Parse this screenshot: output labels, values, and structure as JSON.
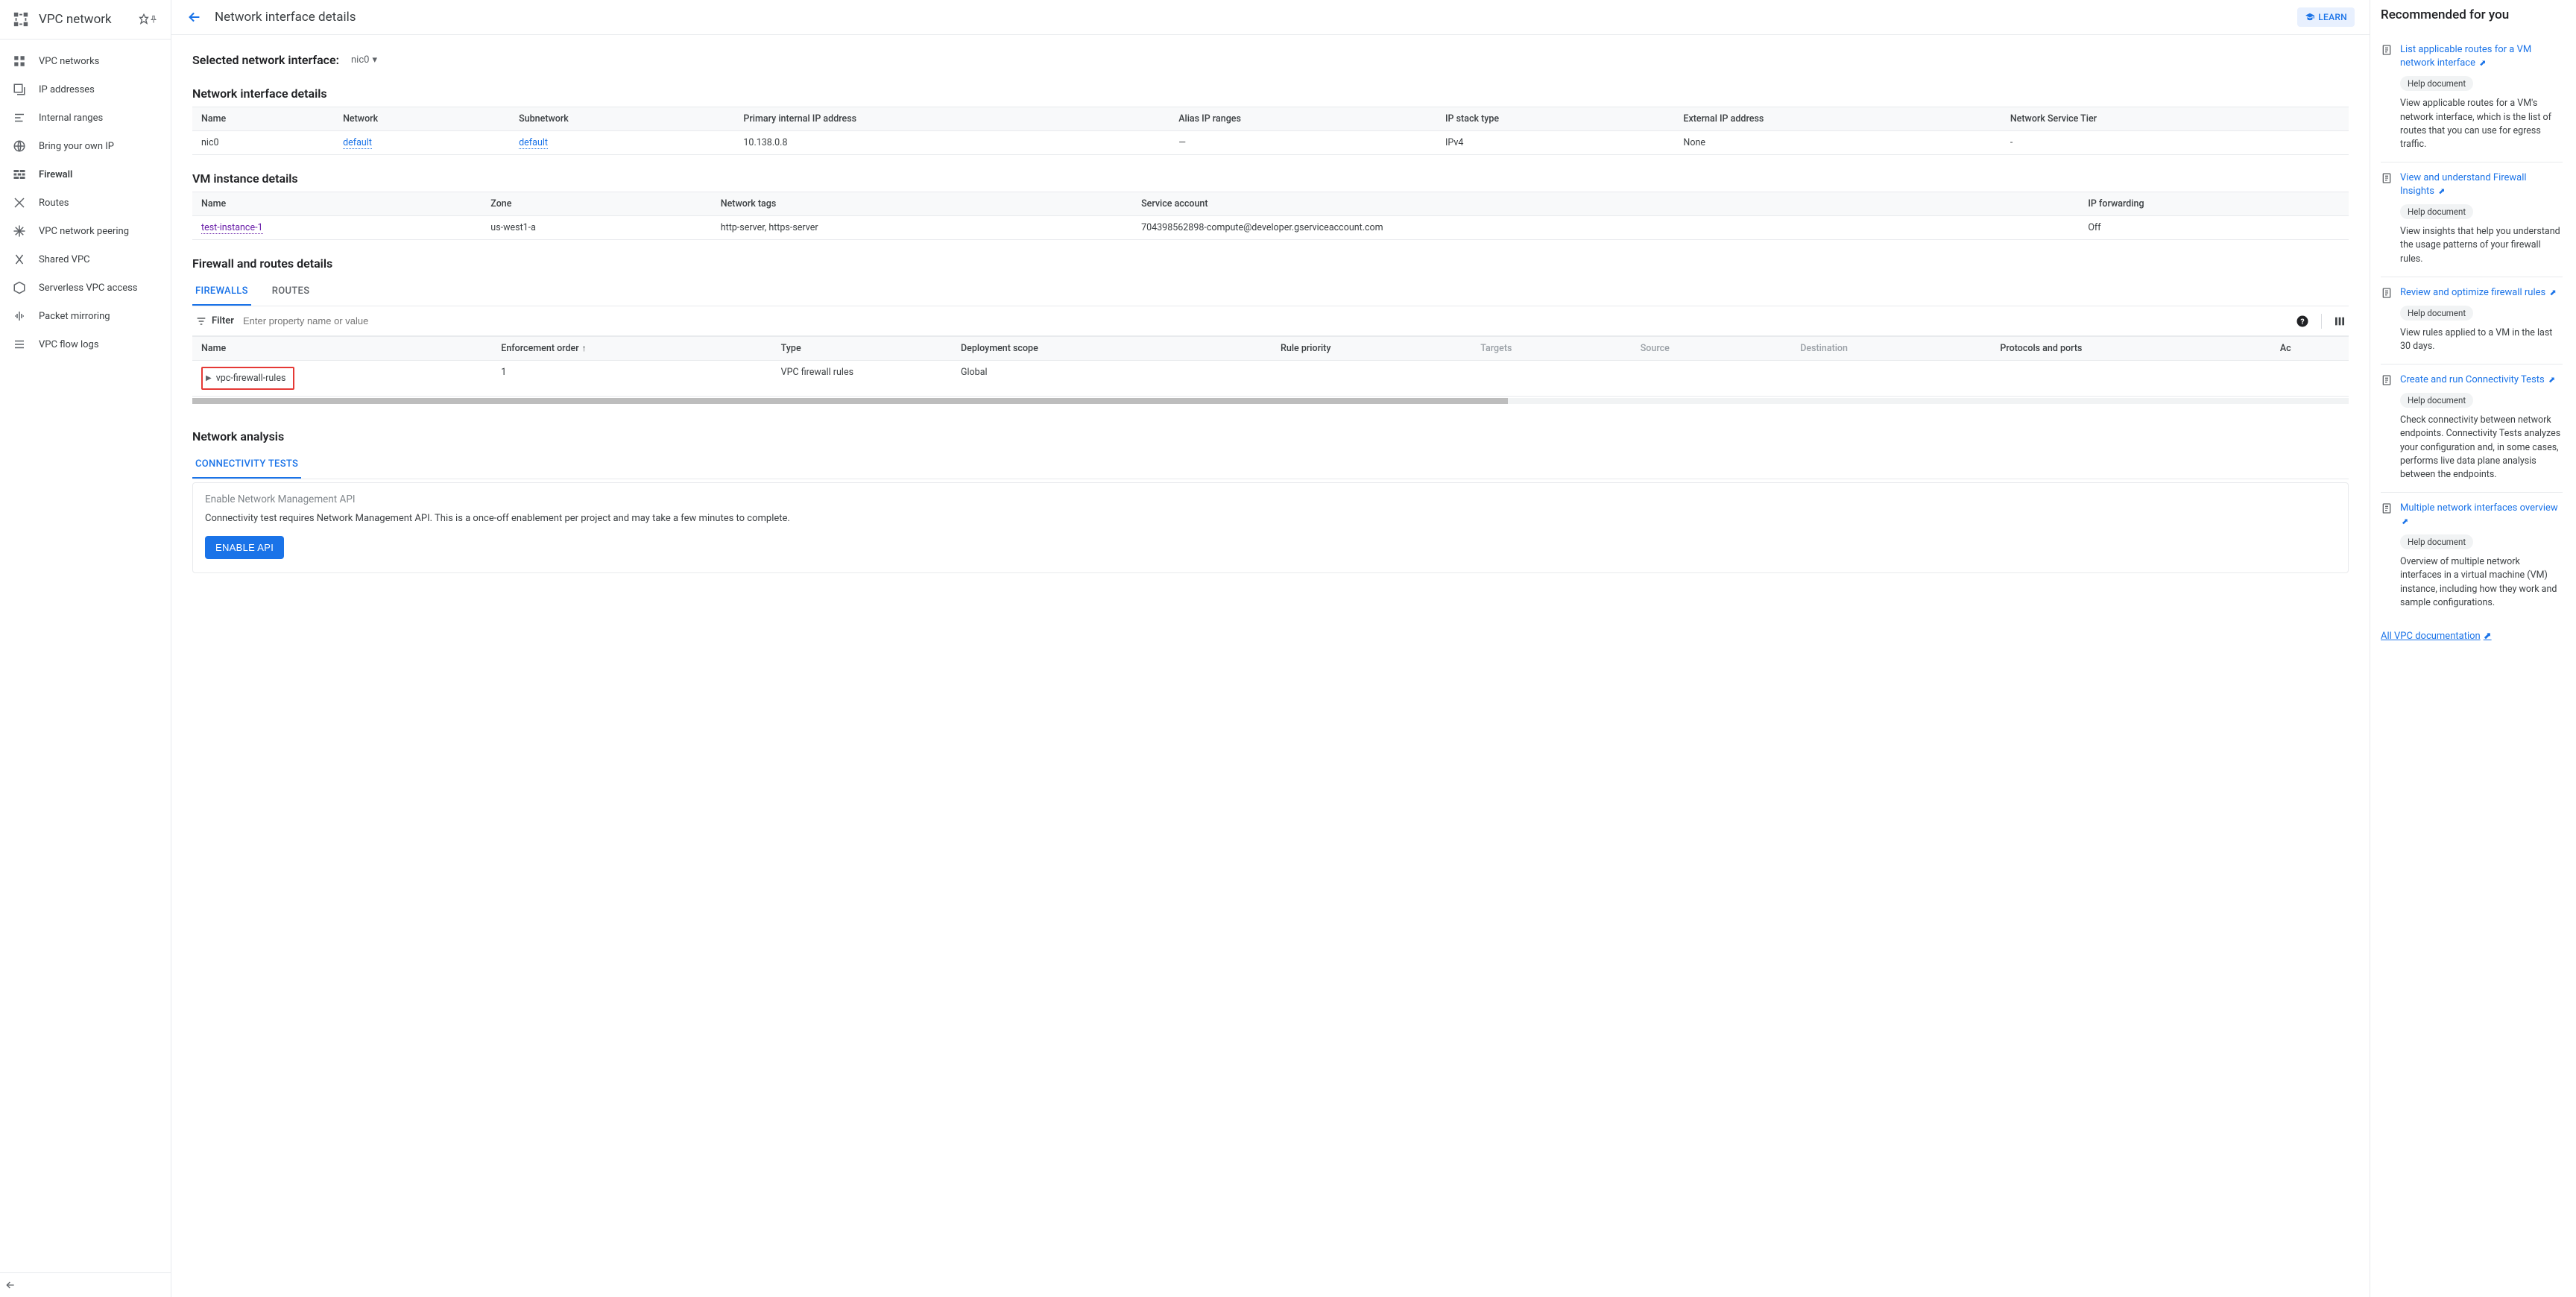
{
  "sidebar": {
    "product": "VPC network",
    "items": [
      {
        "label": "VPC networks",
        "icon": "vpc-networks-icon"
      },
      {
        "label": "IP addresses",
        "icon": "ip-addresses-icon"
      },
      {
        "label": "Internal ranges",
        "icon": "internal-ranges-icon"
      },
      {
        "label": "Bring your own IP",
        "icon": "byoip-icon"
      },
      {
        "label": "Firewall",
        "icon": "firewall-icon",
        "active": true
      },
      {
        "label": "Routes",
        "icon": "routes-icon"
      },
      {
        "label": "VPC network peering",
        "icon": "peering-icon"
      },
      {
        "label": "Shared VPC",
        "icon": "shared-vpc-icon"
      },
      {
        "label": "Serverless VPC access",
        "icon": "serverless-icon"
      },
      {
        "label": "Packet mirroring",
        "icon": "packet-mirroring-icon"
      },
      {
        "label": "VPC flow logs",
        "icon": "flow-logs-icon"
      }
    ]
  },
  "header": {
    "page_title": "Network interface details",
    "learn_label": "LEARN"
  },
  "selected_interface": {
    "label": "Selected network interface:",
    "value": "nic0"
  },
  "nic_details": {
    "title": "Network interface details",
    "headers": [
      "Name",
      "Network",
      "Subnetwork",
      "Primary internal IP address",
      "Alias IP ranges",
      "IP stack type",
      "External IP address",
      "Network Service Tier"
    ],
    "row": {
      "name": "nic0",
      "network": "default",
      "subnetwork": "default",
      "primary_ip": "10.138.0.8",
      "alias": "—",
      "stack": "IPv4",
      "external": "None",
      "tier": "-"
    }
  },
  "vm_details": {
    "title": "VM instance details",
    "headers": [
      "Name",
      "Zone",
      "Network tags",
      "Service account",
      "IP forwarding"
    ],
    "row": {
      "name": "test-instance-1",
      "zone": "us-west1-a",
      "tags": "http-server, https-server",
      "service_account": "704398562898-compute@developer.gserviceaccount.com",
      "ip_fwd": "Off"
    }
  },
  "firewall_routes": {
    "title": "Firewall and routes details",
    "tabs": [
      "FIREWALLS",
      "ROUTES"
    ],
    "active_tab": 0,
    "filter_label": "Filter",
    "filter_placeholder": "Enter property name or value",
    "headers": [
      "Name",
      "Enforcement order",
      "Type",
      "Deployment scope",
      "Rule priority",
      "Targets",
      "Source",
      "Destination",
      "Protocols and ports",
      "Ac"
    ],
    "row": {
      "name": "vpc-firewall-rules",
      "order": "1",
      "type": "VPC firewall rules",
      "scope": "Global",
      "priority": "",
      "targets": "",
      "source": "",
      "destination": "",
      "protocols": ""
    }
  },
  "analysis": {
    "title": "Network analysis",
    "tab": "CONNECTIVITY TESTS",
    "api_title": "Enable Network Management API",
    "api_desc": "Connectivity test requires Network Management API. This is a once-off enablement per project and may take a few minutes to complete.",
    "button": "ENABLE API"
  },
  "recommended": {
    "title": "Recommended for you",
    "badge": "Help document",
    "items": [
      {
        "title": "List applicable routes for a VM network interface",
        "desc": "View applicable routes for a VM's network interface, which is the list of routes that you can use for egress traffic."
      },
      {
        "title": "View and understand Firewall Insights",
        "desc": "View insights that help you understand the usage patterns of your firewall rules."
      },
      {
        "title": "Review and optimize firewall rules",
        "desc": "View rules applied to a VM in the last 30 days."
      },
      {
        "title": "Create and run Connectivity Tests",
        "desc": "Check connectivity between network endpoints. Connectivity Tests analyzes your configuration and, in some cases, performs live data plane analysis between the endpoints."
      },
      {
        "title": "Multiple network interfaces overview",
        "desc": "Overview of multiple network interfaces in a virtual machine (VM) instance, including how they work and sample configurations."
      }
    ],
    "all_docs": "All VPC documentation"
  }
}
